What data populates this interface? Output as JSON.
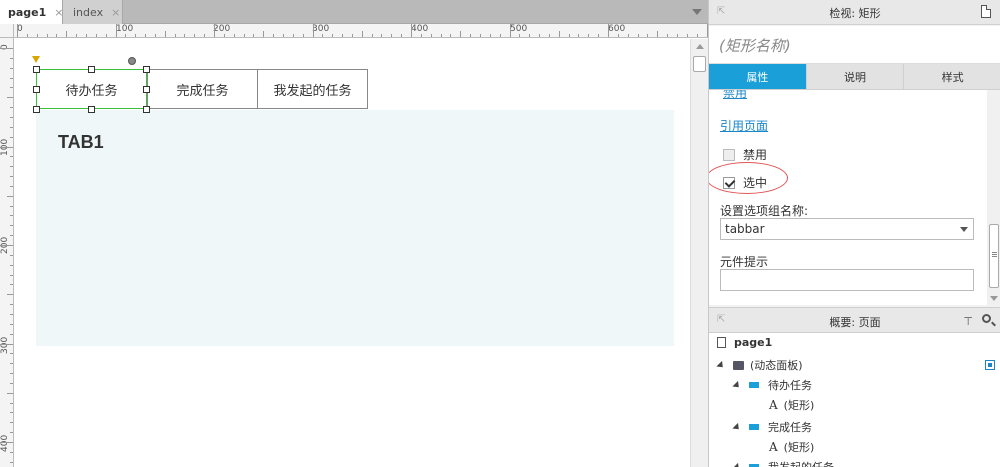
{
  "editor": {
    "tabs": [
      {
        "label": "page1",
        "close": "×"
      },
      {
        "label": "index",
        "close": "×"
      }
    ],
    "ruler_h": [
      "0",
      "100",
      "200",
      "300",
      "400",
      "500",
      "600"
    ],
    "ruler_v": [
      "0",
      "100",
      "200",
      "300",
      "400"
    ]
  },
  "canvas": {
    "tab_buttons": [
      "待办任务",
      "完成任务",
      "我发起的任务"
    ],
    "panel_title": "TAB1"
  },
  "inspector": {
    "title": "检视: 矩形",
    "name_placeholder": "(矩形名称)",
    "tabs": [
      "属性",
      "说明",
      "样式"
    ],
    "link_top": "禁用",
    "link_ref": "引用页面",
    "disabled_label": "禁用",
    "selected_label": "选中",
    "group_label": "设置选项组名称:",
    "group_value": "tabbar",
    "tooltip_label": "元件提示",
    "tooltip_value": ""
  },
  "outline": {
    "title": "概要: 页面",
    "filter_icon": "filter-icon",
    "search_icon": "search-icon",
    "items": {
      "page": "page1",
      "dynamic_panel": "(动态面板)",
      "state1": "待办任务",
      "state1_child": "(矩形)",
      "state2": "完成任务",
      "state2_child": "(矩形)",
      "state3": "我发起的任务"
    }
  },
  "colors": {
    "accent": "#1a9fd9",
    "selection": "#3bbf3b",
    "panel_bg": "#f0f7f8",
    "highlight": "#e25555"
  }
}
